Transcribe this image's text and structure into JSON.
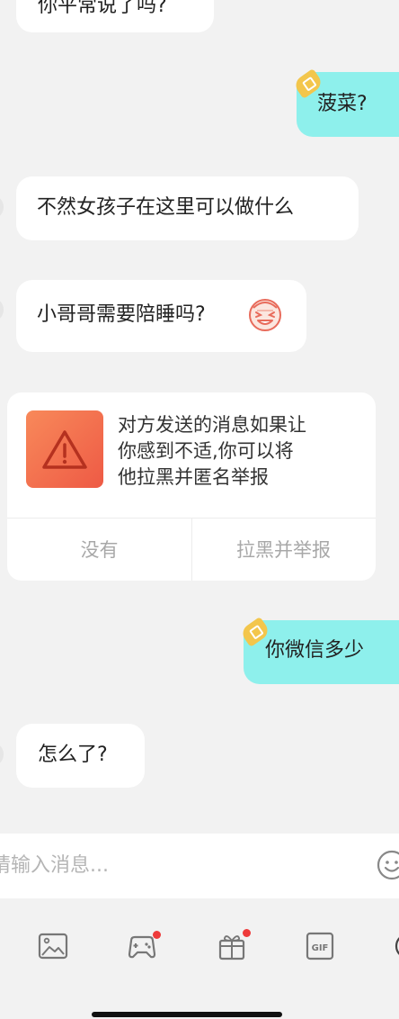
{
  "messages": [
    {
      "text": "你平常说了吗?"
    },
    {
      "text": "菠菜?"
    },
    {
      "text": "不然女孩子在这里可以做什么"
    },
    {
      "text": "小哥哥需要陪睡吗?"
    },
    {
      "text": "你微信多少"
    },
    {
      "text": "怎么了?"
    }
  ],
  "safety_notice": {
    "line1": "对方发送的消息如果让",
    "line2": "你感到不适,你可以将",
    "line3": "他拉黑并匿名举报",
    "dismiss_label": "没有",
    "report_label": "拉黑并举报"
  },
  "composer": {
    "placeholder": "请输入消息..."
  },
  "toolbar": {
    "items": [
      {
        "icon": "image-icon",
        "badge": false
      },
      {
        "icon": "game-controller-icon",
        "badge": true
      },
      {
        "icon": "gift-icon",
        "badge": true
      },
      {
        "icon": "gif-icon",
        "badge": false,
        "label": "GIF"
      }
    ]
  },
  "colors": {
    "background": "#f2f2f2",
    "incoming_bubble": "#ffffff",
    "outgoing_bubble": "#8ef0ec",
    "warning_gradient_start": "#f8895a",
    "warning_gradient_end": "#ee5a45",
    "badge_dot": "#ee3b3b",
    "vip_badge": "#f3c64c"
  }
}
